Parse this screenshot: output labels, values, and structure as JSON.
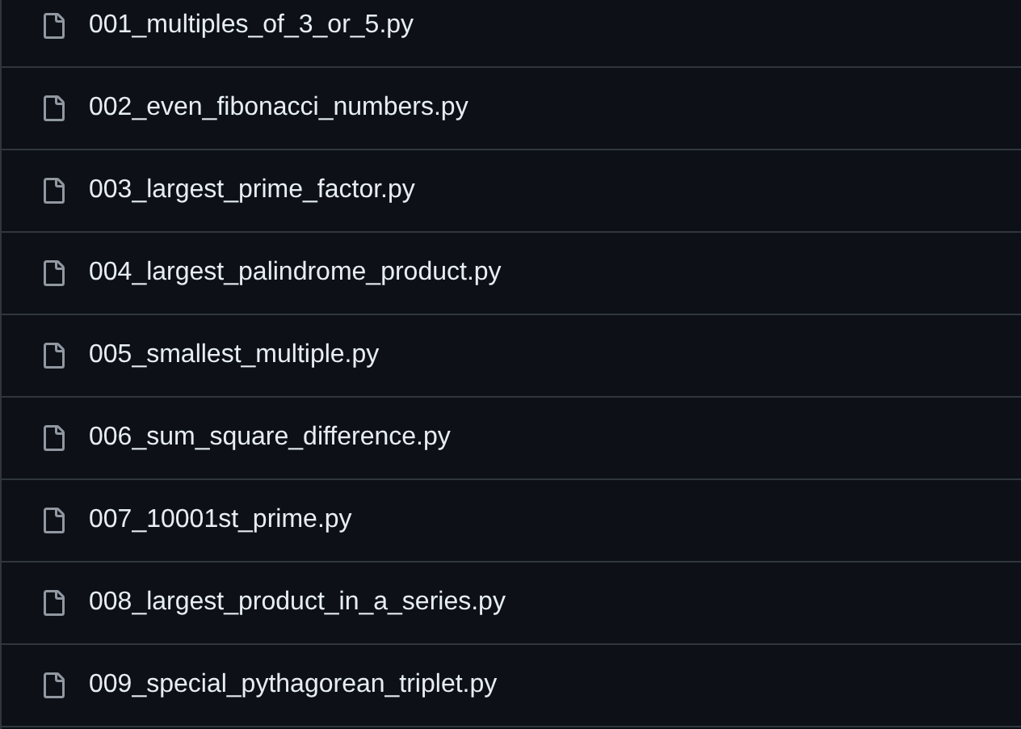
{
  "files": [
    {
      "name": "001_multiples_of_3_or_5.py"
    },
    {
      "name": "002_even_fibonacci_numbers.py"
    },
    {
      "name": "003_largest_prime_factor.py"
    },
    {
      "name": "004_largest_palindrome_product.py"
    },
    {
      "name": "005_smallest_multiple.py"
    },
    {
      "name": "006_sum_square_difference.py"
    },
    {
      "name": "007_10001st_prime.py"
    },
    {
      "name": "008_largest_product_in_a_series.py"
    },
    {
      "name": "009_special_pythagorean_triplet.py"
    }
  ]
}
